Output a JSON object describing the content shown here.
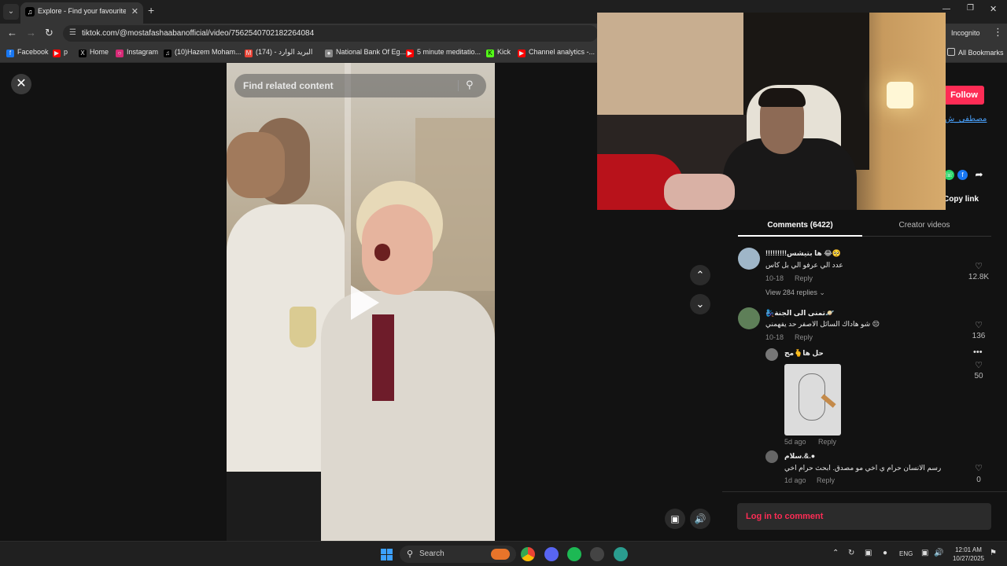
{
  "browser": {
    "tab_title": "Explore - Find your favourite videos",
    "url": "tiktok.com/@mostafashaabanofficial/video/7562540702182264084",
    "incognito_label": "Incognito",
    "bookmarks": [
      {
        "label": "Facebook",
        "color": "#1877f2"
      },
      {
        "label": "p",
        "color": "#ff0000"
      },
      {
        "label": "Home",
        "color": "#000000"
      },
      {
        "label": "Instagram",
        "color": "#d62976"
      },
      {
        "label": "(10)Hazem Moham...",
        "color": "#000000"
      },
      {
        "label": "(174) - البريد الوارد",
        "color": "#ea4335"
      },
      {
        "label": "National Bank Of Eg...",
        "color": "#888888"
      },
      {
        "label": "5 minute meditatio...",
        "color": "#ff0000"
      },
      {
        "label": "Kick",
        "color": "#53fc18"
      },
      {
        "label": "Channel analytics -...",
        "color": "#ff0000"
      }
    ],
    "all_bookmarks_label": "All Bookmarks"
  },
  "video": {
    "search_placeholder": "Find related content"
  },
  "creator": {
    "follow_label": "Follow",
    "author_link": "مصطفى_ش",
    "copy_link_label": "Copy link"
  },
  "panel": {
    "tab_comments": "Comments (6422)",
    "tab_creator_videos": "Creator videos",
    "comments": [
      {
        "name": "!!!!!!!!!ها بتيشس 😂🥺",
        "text": "عدد الي عرفو الي بل كاس",
        "date": "10-18",
        "reply": "Reply",
        "likes": "12.8K",
        "view_replies": "View 284 replies"
      },
      {
        "name": "🧞‍♀️تمنى الى الجنة🪐",
        "text": "شو هاداك السائل الاصفر حد يفهمني 😔",
        "date": "10-18",
        "reply": "Reply",
        "likes": "136"
      }
    ],
    "replies": [
      {
        "name": "حل ها🫰مج",
        "date": "5d ago",
        "reply": "Reply",
        "likes": "50"
      },
      {
        "name": "سلام.&.●",
        "text": "رسم الانسان حرام ي اخي مو مصدق. ابحث حرام اخي",
        "date": "1d ago",
        "reply": "Reply",
        "likes": "0"
      }
    ],
    "login_label": "Log in to comment"
  },
  "taskbar": {
    "search_label": "Search",
    "lang": "ENG",
    "time": "12:01 AM",
    "date": "10/27/2025"
  }
}
